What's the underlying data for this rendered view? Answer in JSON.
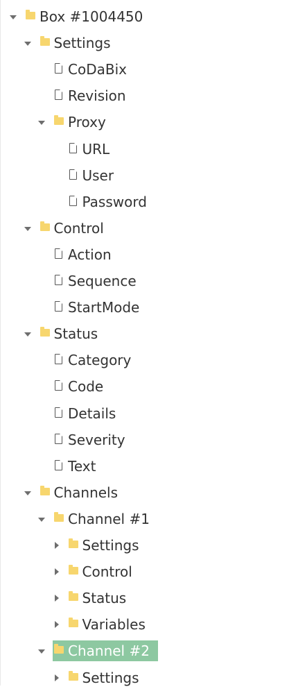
{
  "colors": {
    "folder": "#f7d66e",
    "file_outline": "#555555",
    "toggle_arrow": "#6e6e6e",
    "selected_bg": "#8dc8a1",
    "selected_text": "#ffffff",
    "text": "#333333"
  },
  "tree": [
    {
      "label": "Box #1004450",
      "kind": "folder",
      "depth": 0,
      "toggle": "expanded",
      "name": "tree-node-box-1004450"
    },
    {
      "label": "Settings",
      "kind": "folder",
      "depth": 1,
      "toggle": "expanded",
      "name": "tree-node-settings"
    },
    {
      "label": "CoDaBix",
      "kind": "file",
      "depth": 2,
      "name": "tree-node-codabix"
    },
    {
      "label": "Revision",
      "kind": "file",
      "depth": 2,
      "name": "tree-node-revision"
    },
    {
      "label": "Proxy",
      "kind": "folder",
      "depth": 2,
      "toggle": "expanded",
      "name": "tree-node-proxy"
    },
    {
      "label": "URL",
      "kind": "file",
      "depth": 3,
      "name": "tree-node-url"
    },
    {
      "label": "User",
      "kind": "file",
      "depth": 3,
      "name": "tree-node-user"
    },
    {
      "label": "Password",
      "kind": "file",
      "depth": 3,
      "name": "tree-node-password"
    },
    {
      "label": "Control",
      "kind": "folder",
      "depth": 1,
      "toggle": "expanded",
      "name": "tree-node-control"
    },
    {
      "label": "Action",
      "kind": "file",
      "depth": 2,
      "name": "tree-node-action"
    },
    {
      "label": "Sequence",
      "kind": "file",
      "depth": 2,
      "name": "tree-node-sequence"
    },
    {
      "label": "StartMode",
      "kind": "file",
      "depth": 2,
      "name": "tree-node-startmode"
    },
    {
      "label": "Status",
      "kind": "folder",
      "depth": 1,
      "toggle": "expanded",
      "name": "tree-node-status"
    },
    {
      "label": "Category",
      "kind": "file",
      "depth": 2,
      "name": "tree-node-category"
    },
    {
      "label": "Code",
      "kind": "file",
      "depth": 2,
      "name": "tree-node-code"
    },
    {
      "label": "Details",
      "kind": "file",
      "depth": 2,
      "name": "tree-node-details"
    },
    {
      "label": "Severity",
      "kind": "file",
      "depth": 2,
      "name": "tree-node-severity"
    },
    {
      "label": "Text",
      "kind": "file",
      "depth": 2,
      "name": "tree-node-text"
    },
    {
      "label": "Channels",
      "kind": "folder",
      "depth": 1,
      "toggle": "expanded",
      "name": "tree-node-channels"
    },
    {
      "label": "Channel #1",
      "kind": "folder",
      "depth": 2,
      "toggle": "expanded",
      "name": "tree-node-channel-1"
    },
    {
      "label": "Settings",
      "kind": "folder",
      "depth": 3,
      "toggle": "collapsed",
      "name": "tree-node-channel-1-settings"
    },
    {
      "label": "Control",
      "kind": "folder",
      "depth": 3,
      "toggle": "collapsed",
      "name": "tree-node-channel-1-control"
    },
    {
      "label": "Status",
      "kind": "folder",
      "depth": 3,
      "toggle": "collapsed",
      "name": "tree-node-channel-1-status"
    },
    {
      "label": "Variables",
      "kind": "folder",
      "depth": 3,
      "toggle": "collapsed",
      "name": "tree-node-channel-1-variables"
    },
    {
      "label": "Channel #2",
      "kind": "folder",
      "depth": 2,
      "toggle": "expanded",
      "selected": true,
      "name": "tree-node-channel-2"
    },
    {
      "label": "Settings",
      "kind": "folder",
      "depth": 3,
      "toggle": "collapsed",
      "name": "tree-node-channel-2-settings"
    }
  ]
}
